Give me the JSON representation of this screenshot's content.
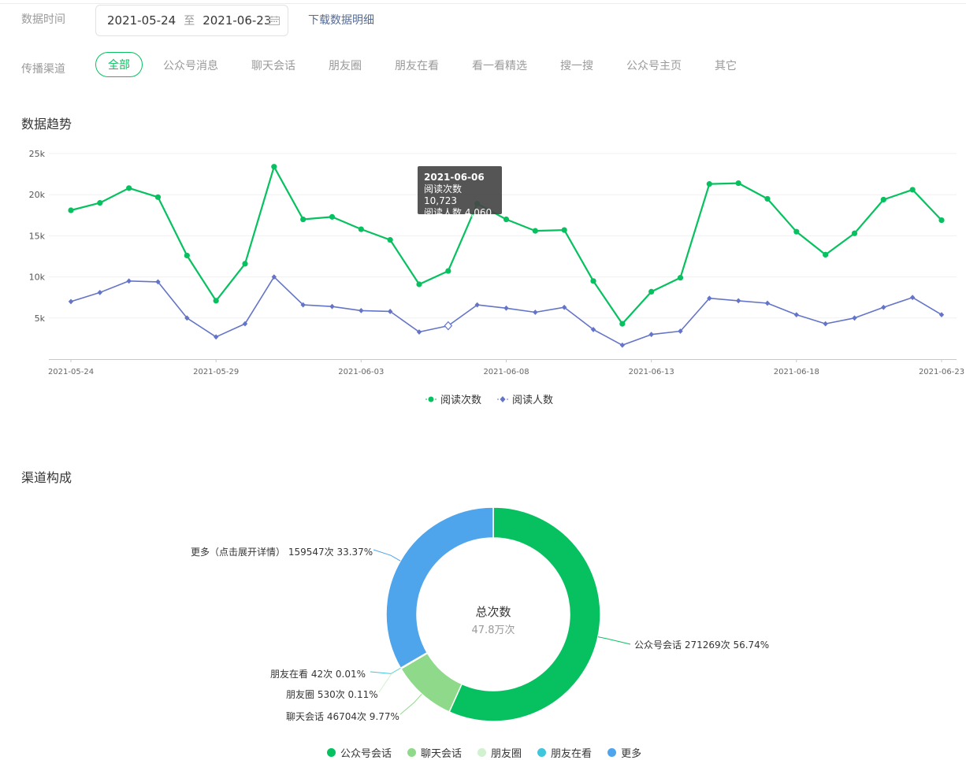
{
  "filters": {
    "date_label": "数据时间",
    "date_start": "2021-05-24",
    "date_sep": "至",
    "date_end": "2021-06-23",
    "download_label": "下载数据明细",
    "channel_label": "传播渠道",
    "channels": [
      "全部",
      "公众号消息",
      "聊天会话",
      "朋友圈",
      "朋友在看",
      "看一看精选",
      "搜一搜",
      "公众号主页",
      "其它"
    ],
    "active_channel": "全部"
  },
  "trend": {
    "title": "数据趋势",
    "tooltip": {
      "date": "2021-06-06",
      "line1": "阅读次数 10,723",
      "line2": "阅读人数 4,060"
    },
    "legend": [
      "阅读次数",
      "阅读人数"
    ]
  },
  "channel_section": {
    "title": "渠道构成",
    "center_title": "总次数",
    "center_value": "47.8万次"
  },
  "colors": {
    "accent_green": "#07c160",
    "series_purple": "#6474c8",
    "pie_green": "#07c160",
    "pie_light_green": "#8fd98a",
    "pie_pale_green": "#d1f1cf",
    "pie_cyan": "#3dc6de",
    "pie_blue": "#4ea5eb",
    "link_blue": "#576b95"
  },
  "chart_data": [
    {
      "type": "line",
      "x": [
        "2021-05-24",
        "2021-05-25",
        "2021-05-26",
        "2021-05-27",
        "2021-05-28",
        "2021-05-29",
        "2021-05-30",
        "2021-05-31",
        "2021-06-01",
        "2021-06-02",
        "2021-06-03",
        "2021-06-04",
        "2021-06-05",
        "2021-06-06",
        "2021-06-07",
        "2021-06-08",
        "2021-06-09",
        "2021-06-10",
        "2021-06-11",
        "2021-06-12",
        "2021-06-13",
        "2021-06-14",
        "2021-06-15",
        "2021-06-16",
        "2021-06-17",
        "2021-06-18",
        "2021-06-19",
        "2021-06-20",
        "2021-06-21",
        "2021-06-22",
        "2021-06-23"
      ],
      "x_ticks": [
        "2021-05-24",
        "2021-05-29",
        "2021-06-03",
        "2021-06-08",
        "2021-06-13",
        "2021-06-18",
        "2021-06-23"
      ],
      "y_ticks": [
        "5k",
        "10k",
        "15k",
        "20k",
        "25k"
      ],
      "ylim": [
        0,
        25000
      ],
      "grid": true,
      "legend_placement": "bottom",
      "series": [
        {
          "name": "阅读次数",
          "color": "#07c160",
          "marker": "circle",
          "values": [
            18100,
            19000,
            20800,
            19700,
            12600,
            7100,
            11600,
            23400,
            17000,
            17300,
            15800,
            14500,
            9100,
            10723,
            18900,
            17000,
            15600,
            15700,
            9500,
            4300,
            8200,
            9900,
            21300,
            21400,
            19500,
            15500,
            12700,
            15300,
            19400,
            20600,
            16900
          ]
        },
        {
          "name": "阅读人数",
          "color": "#6474c8",
          "marker": "diamond",
          "values": [
            7000,
            8100,
            9500,
            9400,
            5000,
            2700,
            4300,
            10000,
            6600,
            6400,
            5900,
            5800,
            3300,
            4060,
            6600,
            6200,
            5700,
            6300,
            3600,
            1700,
            3000,
            3400,
            7400,
            7100,
            6800,
            5400,
            4300,
            5000,
            6300,
            7500,
            5400
          ]
        }
      ]
    },
    {
      "type": "pie",
      "donut": true,
      "legend_placement": "bottom",
      "slices": [
        {
          "name": "公众号会话",
          "value": 271269,
          "percent": 56.74,
          "label": "公众号会话 271269次 56.74%",
          "color": "#07c160"
        },
        {
          "name": "聊天会话",
          "value": 46704,
          "percent": 9.77,
          "label": "聊天会话 46704次 9.77%",
          "color": "#8fd98a"
        },
        {
          "name": "朋友圈",
          "value": 530,
          "percent": 0.11,
          "label": "朋友圈 530次 0.11%",
          "color": "#d1f1cf"
        },
        {
          "name": "朋友在看",
          "value": 42,
          "percent": 0.01,
          "label": "朋友在看 42次 0.01%",
          "color": "#3dc6de"
        },
        {
          "name": "更多",
          "value": 159547,
          "percent": 33.37,
          "label": "更多（点击展开详情） 159547次 33.37%",
          "color": "#4ea5eb"
        }
      ]
    }
  ]
}
